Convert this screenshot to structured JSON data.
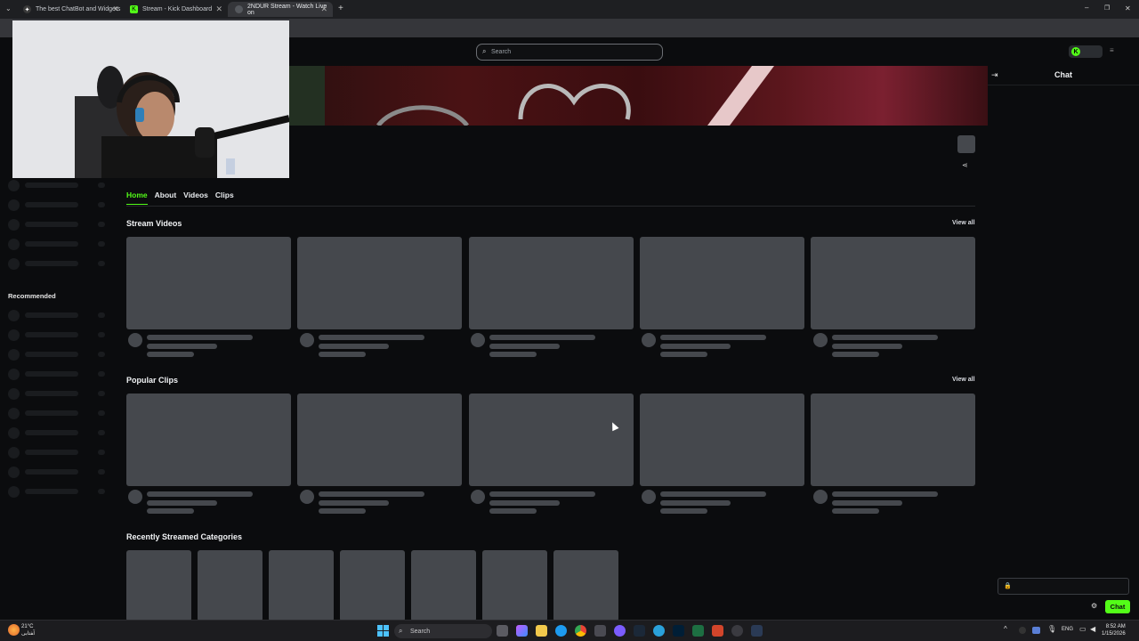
{
  "browser": {
    "tabs": [
      {
        "title": "The best ChatBot and Widgets",
        "active": false
      },
      {
        "title": "Stream - Kick Dashboard",
        "active": false
      },
      {
        "title": "2NDUR Stream - Watch Live on",
        "active": true
      }
    ],
    "new_tab": "+",
    "window_controls": {
      "minimize": "–",
      "maximize": "❐",
      "close": "✕"
    }
  },
  "site": {
    "search_placeholder": "Search",
    "brand_color": "#53fc18"
  },
  "sidebar": {
    "recommended_label": "Recommended"
  },
  "channel": {
    "tabs": [
      "Home",
      "About",
      "Videos",
      "Clips"
    ],
    "active_tab": "Home",
    "sections": {
      "stream_videos": "Stream Videos",
      "popular_clips": "Popular Clips",
      "recent_categories": "Recently Streamed Categories"
    },
    "view_all": "View all"
  },
  "chat": {
    "title": "Chat",
    "send_label": "Chat"
  },
  "taskbar": {
    "search": "Search",
    "weather_temp": "21°C",
    "weather_desc": "ﺁﻔﺘﺎﺑﯽ",
    "lang": "ENG",
    "time": "8:52 AM",
    "date": "1/15/2026"
  }
}
